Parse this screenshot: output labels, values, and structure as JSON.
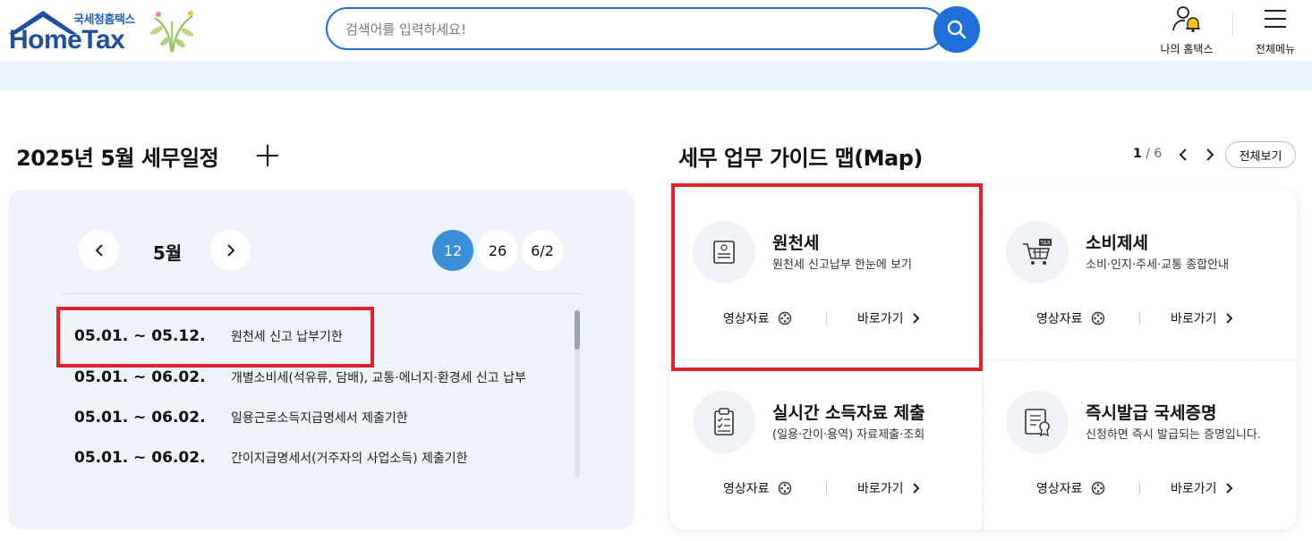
{
  "header": {
    "logo_small": "국세청홈택스",
    "logo_big": "HomeTax",
    "search_placeholder": "검색어를 입력하세요!",
    "my_hometax": "나의 홈택스",
    "all_menu": "전체메뉴"
  },
  "schedule": {
    "title": "2025년 5월 세무일정",
    "month": "5월",
    "days": [
      "12",
      "26",
      "6/2"
    ],
    "items": [
      {
        "date": "05.01. ~ 05.12.",
        "desc": "원천세 신고 납부기한"
      },
      {
        "date": "05.01. ~ 06.02.",
        "desc": "개별소비세(석유류, 담배), 교통·에너지·환경세 신고 납부"
      },
      {
        "date": "05.01. ~ 06.02.",
        "desc": "일용근로소득지급명세서 제출기한"
      },
      {
        "date": "05.01. ~ 06.02.",
        "desc": "간이지급명세서(거주자의 사업소득) 제출기한"
      }
    ]
  },
  "guide": {
    "title": "세무 업무 가이드 맵(Map)",
    "page_current": "1",
    "page_total": "/ 6",
    "view_all": "전체보기",
    "cards": [
      {
        "title": "원천세",
        "desc": "원천세 신고납부 한눈에 보기",
        "video": "영상자료",
        "go": "바로가기",
        "icon": "document-icon"
      },
      {
        "title": "소비제세",
        "desc": "소비·인지·주세·교통 종합안내",
        "video": "영상자료",
        "go": "바로가기",
        "icon": "tax-cart-icon"
      },
      {
        "title": "실시간 소득자료 제출",
        "desc": "(일용·간이·용역) 자료제출·조회",
        "video": "영상자료",
        "go": "바로가기",
        "icon": "clipboard-icon"
      },
      {
        "title": "즉시발급 국세증명",
        "desc": "신청하면 즉시 발급되는 증명입니다.",
        "video": "영상자료",
        "go": "바로가기",
        "icon": "certificate-icon"
      }
    ]
  },
  "colors": {
    "accent": "#1f6fd8",
    "active_day": "#3a8fd6",
    "highlight": "#e0222b",
    "card_bg": "#eef3fa"
  }
}
